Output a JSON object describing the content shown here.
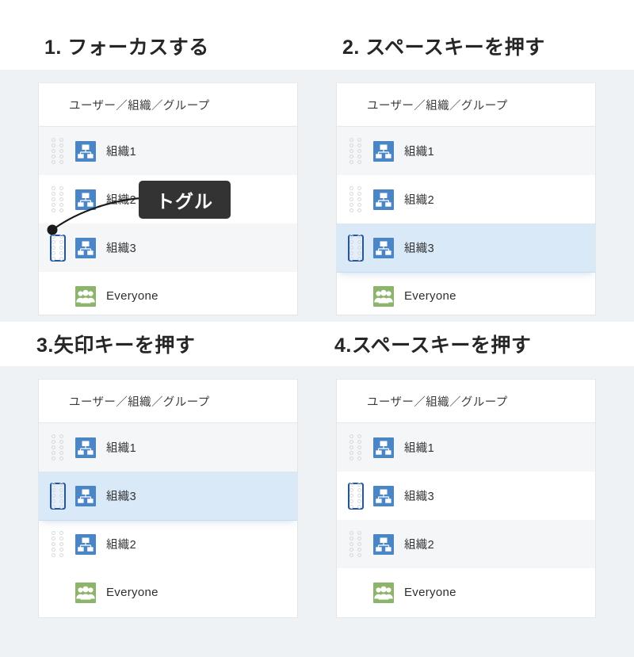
{
  "page": {
    "background_color": "#ffffff",
    "plate_color": "#eff2f4",
    "accent_focus_color": "#2255a4",
    "selected_row_color": "#d9e9f8",
    "callout_bg_color": "#333333",
    "org_icon_color": "#4a86c5",
    "group_icon_color": "#8cb46a"
  },
  "callout": {
    "label": "トグル",
    "target": "drag-handle of 組織3 in step 1"
  },
  "steps": [
    {
      "id": "step-1",
      "title": "1. フォーカスする",
      "list": {
        "header": "ユーザー／組織／グループ",
        "rows": [
          {
            "label": "組織1",
            "icon": "org-icon",
            "handle": true,
            "focused": false,
            "selected": false,
            "shade": true
          },
          {
            "label": "組織2",
            "icon": "org-icon",
            "handle": true,
            "focused": false,
            "selected": false,
            "shade": false
          },
          {
            "label": "組織3",
            "icon": "org-icon",
            "handle": true,
            "focused": true,
            "selected": false,
            "shade": true
          },
          {
            "label": "Everyone",
            "icon": "group-icon",
            "handle": false,
            "focused": false,
            "selected": false,
            "shade": false
          }
        ]
      }
    },
    {
      "id": "step-2",
      "title": "2. スペースキーを押す",
      "list": {
        "header": "ユーザー／組織／グループ",
        "rows": [
          {
            "label": "組織1",
            "icon": "org-icon",
            "handle": true,
            "focused": false,
            "selected": false,
            "shade": true
          },
          {
            "label": "組織2",
            "icon": "org-icon",
            "handle": true,
            "focused": false,
            "selected": false,
            "shade": false
          },
          {
            "label": "組織3",
            "icon": "org-icon",
            "handle": true,
            "focused": true,
            "selected": true,
            "shade": false
          },
          {
            "label": "Everyone",
            "icon": "group-icon",
            "handle": false,
            "focused": false,
            "selected": false,
            "shade": false
          }
        ]
      }
    },
    {
      "id": "step-3",
      "title": "3.矢印キーを押す",
      "list": {
        "header": "ユーザー／組織／グループ",
        "rows": [
          {
            "label": "組織1",
            "icon": "org-icon",
            "handle": true,
            "focused": false,
            "selected": false,
            "shade": true
          },
          {
            "label": "組織3",
            "icon": "org-icon",
            "handle": true,
            "focused": true,
            "selected": true,
            "shade": false
          },
          {
            "label": "組織2",
            "icon": "org-icon",
            "handle": true,
            "focused": false,
            "selected": false,
            "shade": false
          },
          {
            "label": "Everyone",
            "icon": "group-icon",
            "handle": false,
            "focused": false,
            "selected": false,
            "shade": false
          }
        ]
      }
    },
    {
      "id": "step-4",
      "title": "4.スペースキーを押す",
      "list": {
        "header": "ユーザー／組織／グループ",
        "rows": [
          {
            "label": "組織1",
            "icon": "org-icon",
            "handle": true,
            "focused": false,
            "selected": false,
            "shade": true
          },
          {
            "label": "組織3",
            "icon": "org-icon",
            "handle": true,
            "focused": true,
            "selected": false,
            "shade": false
          },
          {
            "label": "組織2",
            "icon": "org-icon",
            "handle": true,
            "focused": false,
            "selected": false,
            "shade": true
          },
          {
            "label": "Everyone",
            "icon": "group-icon",
            "handle": false,
            "focused": false,
            "selected": false,
            "shade": false
          }
        ]
      }
    }
  ]
}
